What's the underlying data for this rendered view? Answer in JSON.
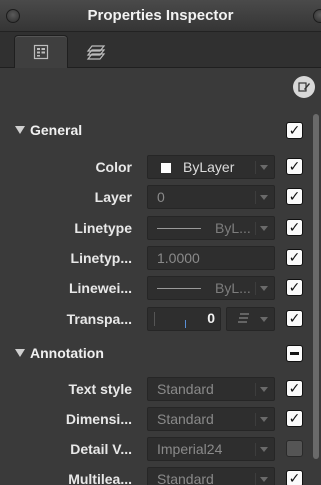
{
  "window": {
    "title": "Properties Inspector"
  },
  "tabs": [
    {
      "name": "properties-tab",
      "icon": "properties-list-icon",
      "active": true
    },
    {
      "name": "layers-tab",
      "icon": "layers-icon",
      "active": false
    }
  ],
  "toolbar": {
    "edit_icon": "edit-pencil-icon"
  },
  "sections": {
    "general": {
      "label": "General",
      "checked": true
    },
    "annotation": {
      "label": "Annotation",
      "checked": "mixed"
    }
  },
  "general": {
    "color": {
      "label": "Color",
      "value": "ByLayer",
      "checked": true
    },
    "layer": {
      "label": "Layer",
      "value": "0",
      "checked": true
    },
    "linetype": {
      "label": "Linetype",
      "value": "ByL...",
      "checked": true
    },
    "linetype_scale": {
      "label": "Linetyp...",
      "value": "1.0000",
      "checked": true
    },
    "lineweight": {
      "label": "Linewei...",
      "value": "ByL...",
      "checked": true
    },
    "transparency": {
      "label": "Transpa...",
      "value": "0",
      "checked": true
    }
  },
  "annotation": {
    "text_style": {
      "label": "Text style",
      "value": "Standard",
      "checked": true
    },
    "dimension": {
      "label": "Dimensi...",
      "value": "Standard",
      "checked": true
    },
    "detail_view": {
      "label": "Detail V...",
      "value": "Imperial24",
      "checked": false
    },
    "multileader": {
      "label": "Multilea...",
      "value": "Standard",
      "checked": true
    }
  },
  "check_glyph": "✓"
}
